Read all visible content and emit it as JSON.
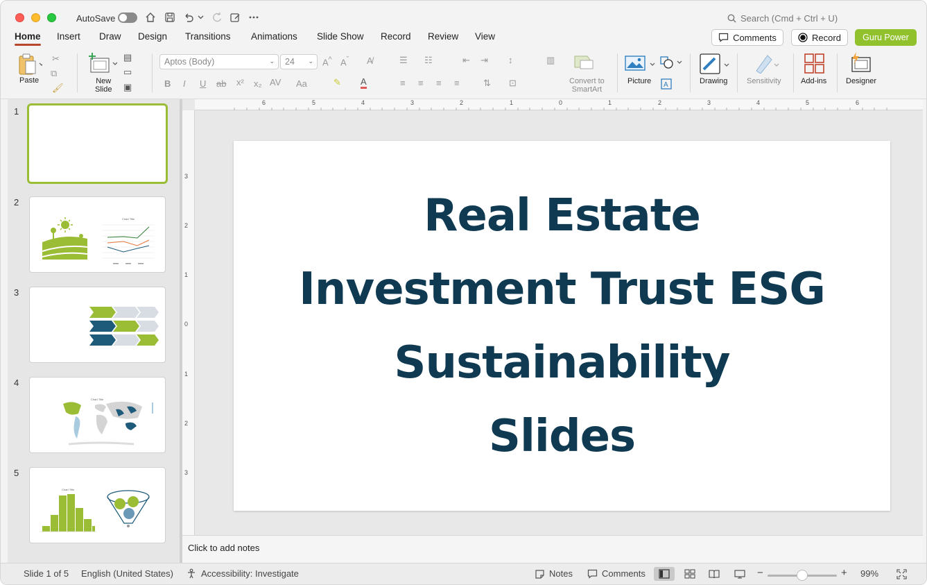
{
  "titlebar": {
    "autosave_label": "AutoSave",
    "search_placeholder": "Search (Cmd + Ctrl + U)"
  },
  "tabs": [
    {
      "label": "Home",
      "active": true
    },
    {
      "label": "Insert"
    },
    {
      "label": "Draw"
    },
    {
      "label": "Design"
    },
    {
      "label": "Transitions"
    },
    {
      "label": "Animations"
    },
    {
      "label": "Slide Show"
    },
    {
      "label": "Record"
    },
    {
      "label": "Review"
    },
    {
      "label": "View"
    }
  ],
  "header_buttons": {
    "comments": "Comments",
    "record": "Record",
    "guru": "Guru Power"
  },
  "ribbon": {
    "paste": "Paste",
    "new_slide_line1": "New",
    "new_slide_line2": "Slide",
    "font_name": "Aptos (Body)",
    "font_size": "24",
    "convert_line1": "Convert to",
    "convert_line2": "SmartArt",
    "picture": "Picture",
    "drawing": "Drawing",
    "sensitivity": "Sensitivity",
    "addins": "Add-ins",
    "designer": "Designer"
  },
  "slides": [
    {
      "number": "1"
    },
    {
      "number": "2"
    },
    {
      "number": "3"
    },
    {
      "number": "4"
    },
    {
      "number": "5"
    }
  ],
  "ruler": {
    "h_ticks": [
      "6",
      "5",
      "4",
      "3",
      "2",
      "1",
      "0",
      "1",
      "2",
      "3",
      "4",
      "5",
      "6"
    ],
    "v_ticks": [
      "3",
      "2",
      "1",
      "0",
      "1",
      "2",
      "3"
    ]
  },
  "slide": {
    "title_lines": [
      "Real Estate",
      "Investment Trust ESG",
      "Sustainability",
      "Slides"
    ]
  },
  "notes_placeholder": "Click to add notes",
  "statusbar": {
    "slide_count": "Slide 1 of 5",
    "language": "English (United States)",
    "accessibility": "Accessibility: Investigate",
    "notes": "Notes",
    "comments": "Comments",
    "zoom": "99%"
  },
  "colors": {
    "accent_tab": "#b7472a",
    "brand_green": "#92c12e",
    "title_navy": "#0f3a52"
  }
}
